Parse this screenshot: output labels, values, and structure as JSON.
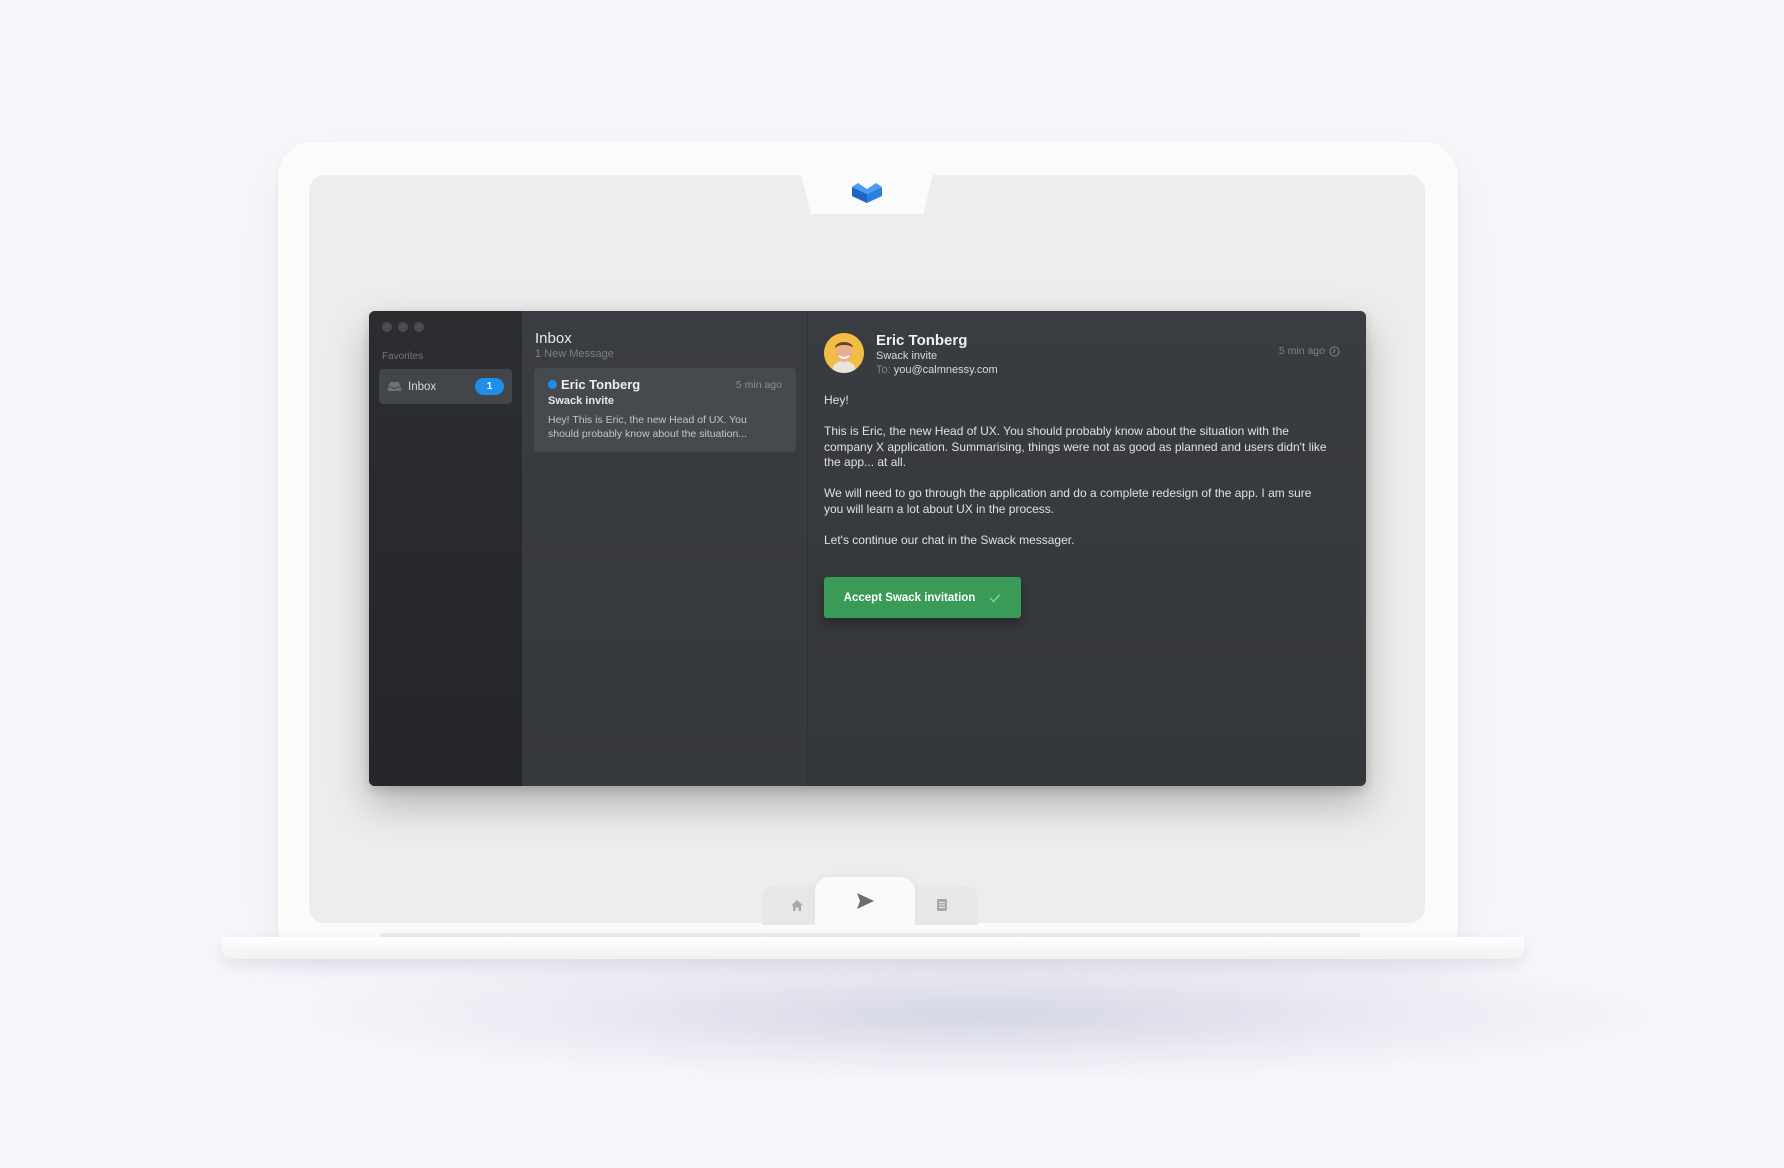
{
  "sidebar": {
    "favorites_label": "Favorites",
    "inbox_label": "Inbox",
    "inbox_badge": "1"
  },
  "list": {
    "title": "Inbox",
    "subtitle": "1 New Message",
    "messages": [
      {
        "sender": "Eric Tonberg",
        "time": "5 min ago",
        "subject": "Swack invite",
        "preview_line1": "Hey! This is Eric, the new Head of UX. You",
        "preview_line2": "should probably know about the situation..."
      }
    ]
  },
  "reader": {
    "from_name": "Eric Tonberg",
    "subject": "Swack invite",
    "to_label": "To:",
    "to_address": "you@calmnessy.com",
    "time": "5 min ago",
    "body": [
      "Hey!",
      "This is Eric, the new Head of UX. You should probably know about the situation with the company X application. Summarising, things were not as good as planned and users didn't like the app... at all.",
      "We will need to go through the application and do a complete redesign of the app. I am sure you will learn a lot about UX in the process.",
      "Let's continue our chat in the Swack messager."
    ],
    "accept_button_label": "Accept Swack invitation"
  },
  "colors": {
    "accent_blue": "#1e8ee9",
    "button_green": "#3a9b59",
    "window_bg": "#373a3e",
    "sidebar_bg": "#2b2d31",
    "logo_blue": "#2b7fe0"
  },
  "icons": {
    "logo": "open-box-logo-icon",
    "dock": [
      "home-icon",
      "send-icon",
      "document-icon"
    ],
    "inbox": "inbox-tray-icon",
    "clock": "clock-icon",
    "check": "checkmark-icon"
  }
}
